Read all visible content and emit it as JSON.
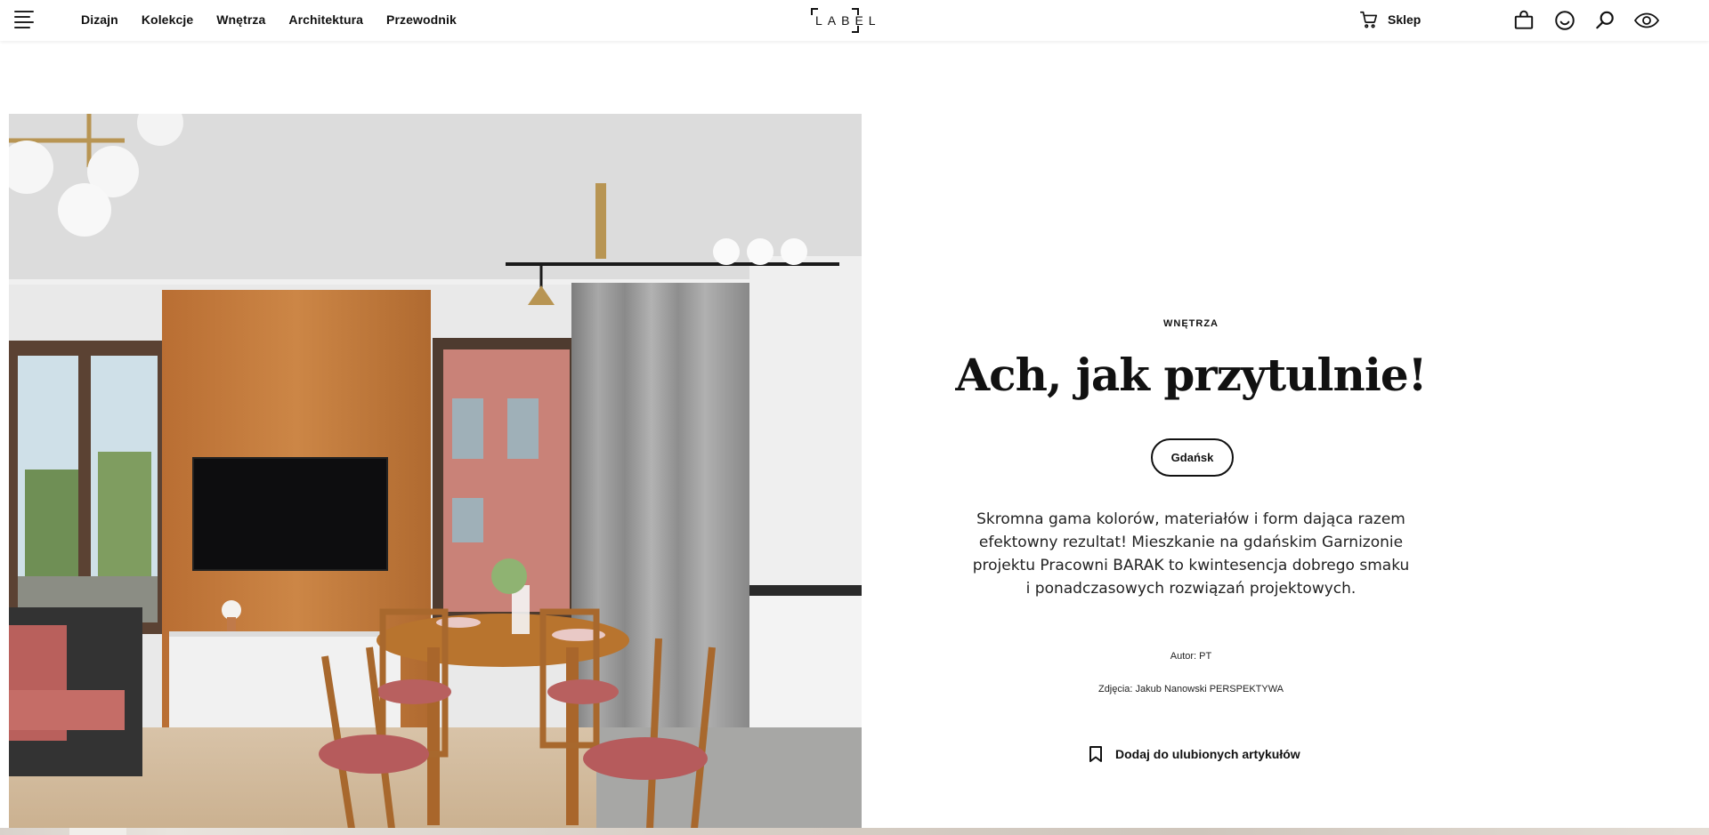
{
  "nav": {
    "items": [
      {
        "label": "Dizajn"
      },
      {
        "label": "Kolekcje"
      },
      {
        "label": "Wnętrza"
      },
      {
        "label": "Architektura"
      },
      {
        "label": "Przewodnik"
      }
    ]
  },
  "logo": {
    "text": "LABEL"
  },
  "shop": {
    "label": "Sklep",
    "icon": "cart-icon"
  },
  "header_icons": [
    "bag-icon",
    "smile-icon",
    "search-icon",
    "eye-icon"
  ],
  "article": {
    "category": "WNĘTRZA",
    "title": "Ach, jak przytulnie!",
    "location": "Gdańsk",
    "lead": "Skromna gama kolorów, materiałów i form dająca razem efektowny rezultat! Mieszkanie na gdańskim Garnizonie projektu Pracowni BARAK to kwintesencja dobrego smaku i ponadczasowych rozwiązań projektowych.",
    "author": "Autor: PT",
    "photos": "Zdjęcia: Jakub Nanowski PERSPEKTYWA",
    "favorite_label": "Dodaj do ulubionych artykułów",
    "favorite_icon": "bookmark-icon"
  },
  "colors": {
    "text": "#111111",
    "background": "#ffffff",
    "wood": "#c57a3a",
    "chair_fabric": "#b86b66"
  }
}
